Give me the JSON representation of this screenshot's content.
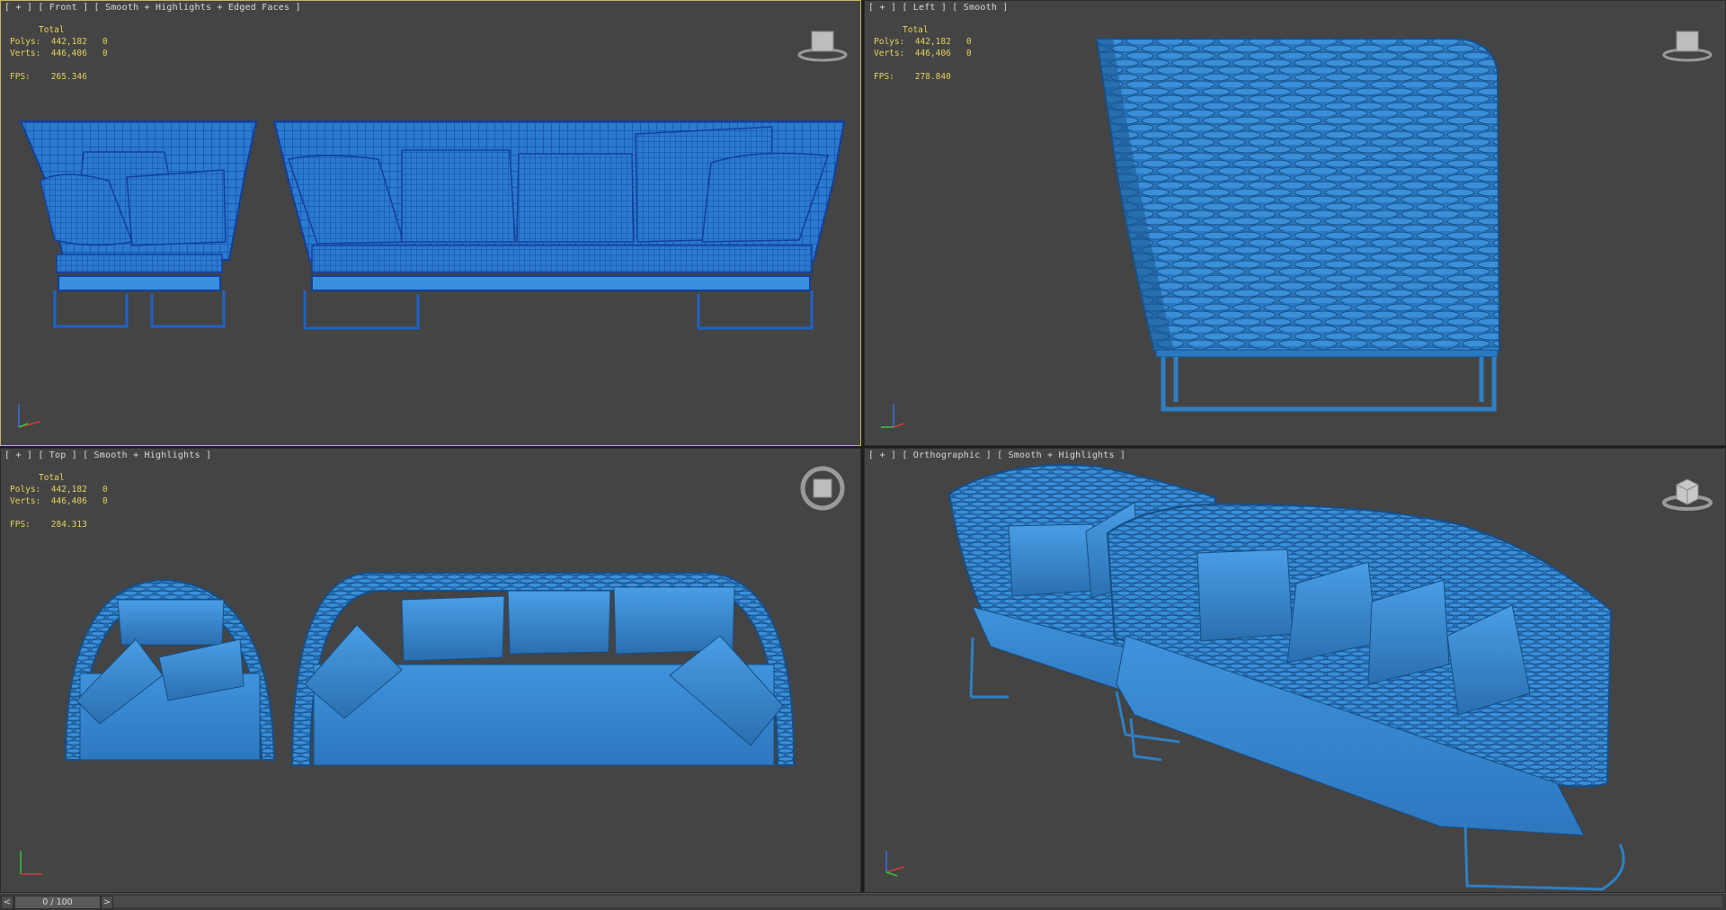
{
  "colors": {
    "viewport_bg": "#444444",
    "active_border": "#c9b75c",
    "stats_text": "#e6d35a",
    "model_blue": "#2f7fc4",
    "wire_blue": "#1f5fc0"
  },
  "viewports": {
    "front": {
      "label": "[ + ] [ Front ] [ Smooth + Highlights + Edged Faces ]",
      "total": "Total",
      "polys": "Polys:  442,182   0",
      "verts": "Verts:  446,406   0",
      "fps": "FPS:    265.346",
      "icon": "viewcube-front-icon"
    },
    "left": {
      "label": "[ + ] [ Left ] [ Smooth ]",
      "total": "Total",
      "polys": "Polys:  442,182   0",
      "verts": "Verts:  446,406   0",
      "fps": "FPS:    278.840",
      "icon": "viewcube-left-icon"
    },
    "top": {
      "label": "[ + ] [ Top ] [ Smooth + Highlights ]",
      "total": "Total",
      "polys": "Polys:  442,182   0",
      "verts": "Verts:  446,406   0",
      "fps": "FPS:    284.313",
      "icon": "viewcube-top-icon"
    },
    "ortho": {
      "label": "[ + ] [ Orthographic ] [ Smooth + Highlights ]",
      "icon": "viewcube-orthographic-icon"
    }
  },
  "timeline": {
    "frame": "0 / 100",
    "prev": "<",
    "next": ">"
  }
}
